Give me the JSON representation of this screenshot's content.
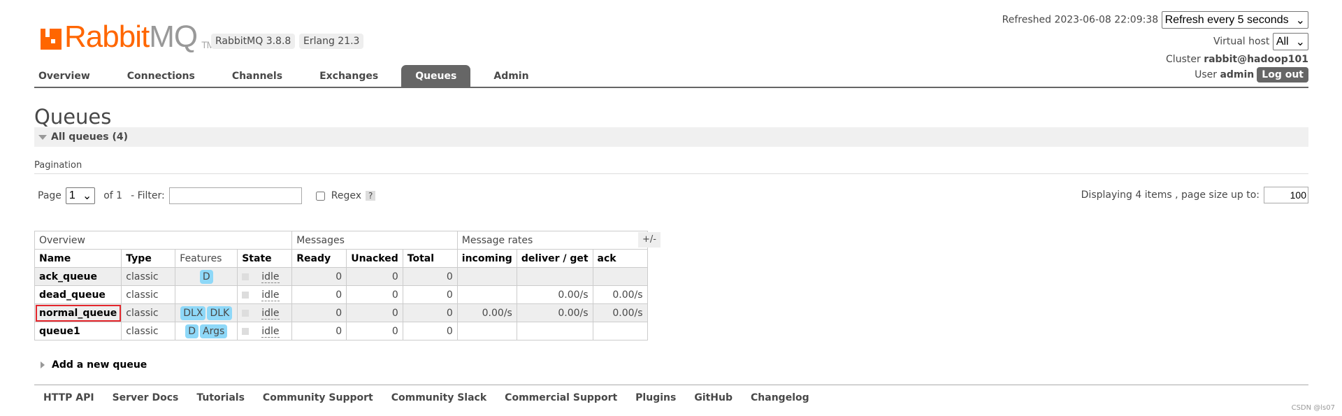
{
  "header": {
    "logo_primary": "Rabbit",
    "logo_secondary": "MQ",
    "logo_tm": "TM",
    "version": "RabbitMQ 3.8.8",
    "erlang": "Erlang 21.3",
    "refreshed": "Refreshed 2023-06-08 22:09:38",
    "refresh_select": "Refresh every 5 seconds",
    "vhost_label": "Virtual host",
    "vhost_value": "All",
    "cluster_label": "Cluster",
    "cluster_value": "rabbit@hadoop101",
    "user_label": "User",
    "user_value": "admin",
    "logout": "Log out"
  },
  "nav": {
    "tabs": [
      {
        "label": "Overview"
      },
      {
        "label": "Connections"
      },
      {
        "label": "Channels"
      },
      {
        "label": "Exchanges"
      },
      {
        "label": "Queues",
        "active": true
      },
      {
        "label": "Admin"
      }
    ]
  },
  "main": {
    "title": "Queues",
    "section": "All queues (4)",
    "pagination_label": "Pagination",
    "page_label": "Page",
    "page_value": "1",
    "of_label": "of 1",
    "filter_label": "- Filter:",
    "filter_value": "",
    "regex_label": "Regex",
    "help": "?",
    "displaying": "Displaying 4 items , page size up to:",
    "page_size": "100",
    "toggle_columns": "+/-",
    "add_queue": "Add a new queue"
  },
  "table": {
    "groups": [
      "Overview",
      "Messages",
      "Message rates"
    ],
    "columns": [
      "Name",
      "Type",
      "Features",
      "State",
      "Ready",
      "Unacked",
      "Total",
      "incoming",
      "deliver / get",
      "ack"
    ],
    "rows": [
      {
        "name": "ack_queue",
        "type": "classic",
        "features": [
          "D"
        ],
        "state": "idle",
        "ready": "0",
        "unacked": "0",
        "total": "0",
        "incoming": "",
        "deliver": "",
        "ack": ""
      },
      {
        "name": "dead_queue",
        "type": "classic",
        "features": [],
        "state": "idle",
        "ready": "0",
        "unacked": "0",
        "total": "0",
        "incoming": "",
        "deliver": "0.00/s",
        "ack": "0.00/s"
      },
      {
        "name": "normal_queue",
        "type": "classic",
        "features": [
          "DLX",
          "DLK"
        ],
        "state": "idle",
        "ready": "0",
        "unacked": "0",
        "total": "0",
        "incoming": "0.00/s",
        "deliver": "0.00/s",
        "ack": "0.00/s",
        "highlighted": true
      },
      {
        "name": "queue1",
        "type": "classic",
        "features": [
          "D",
          "Args"
        ],
        "state": "idle",
        "ready": "0",
        "unacked": "0",
        "total": "0",
        "incoming": "",
        "deliver": "",
        "ack": ""
      }
    ]
  },
  "footer": {
    "links": [
      "HTTP API",
      "Server Docs",
      "Tutorials",
      "Community Support",
      "Community Slack",
      "Commercial Support",
      "Plugins",
      "GitHub",
      "Changelog"
    ]
  },
  "watermark": "CSDN @ls07",
  "colors": {
    "brand": "#ff6600",
    "tab_active": "#666666",
    "feature_badge": "#8ed8f8",
    "highlight": "#e4272d"
  }
}
